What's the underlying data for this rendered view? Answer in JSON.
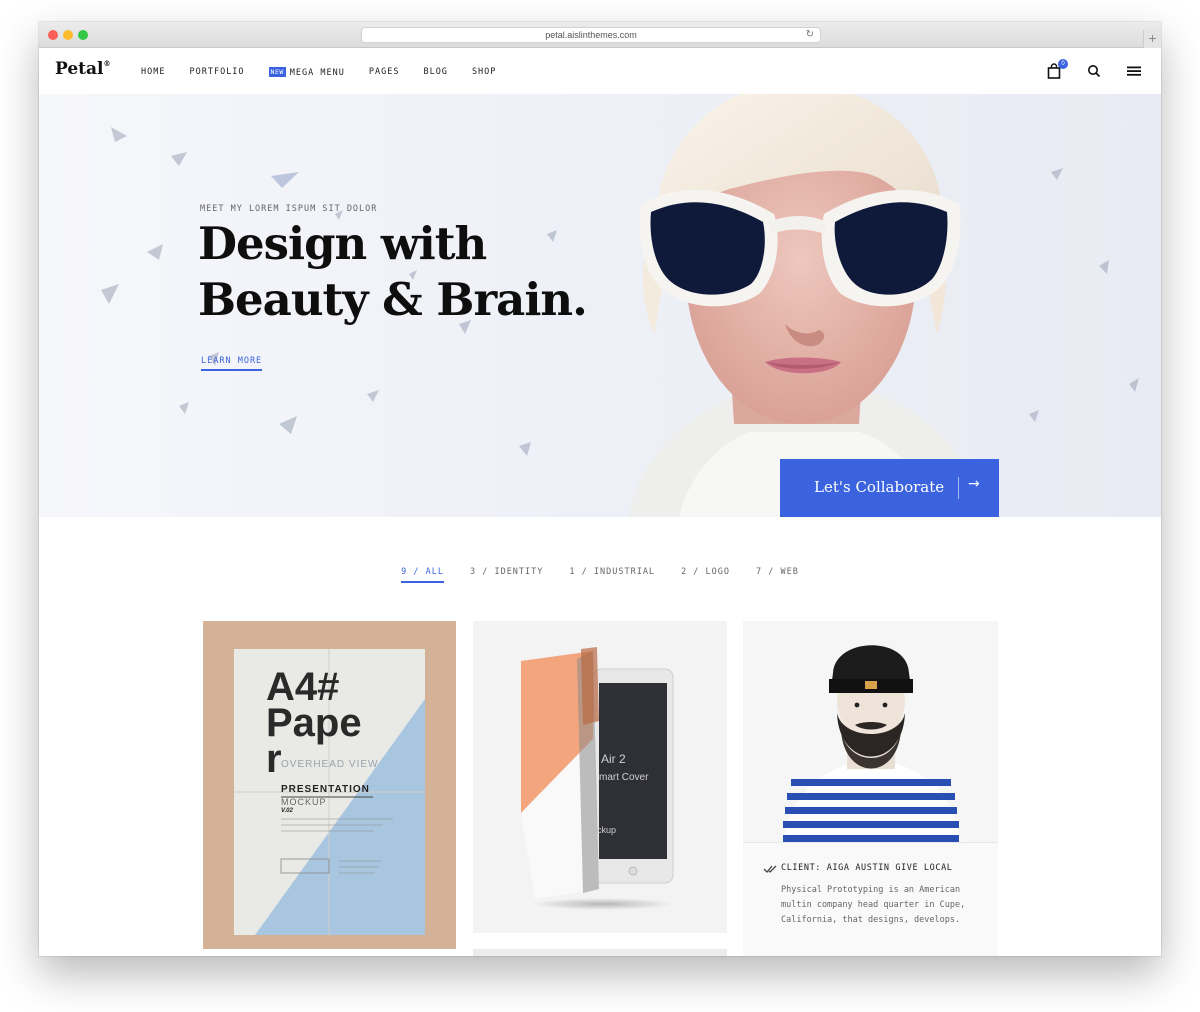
{
  "browser": {
    "url": "petal.aislinthemes.com"
  },
  "nav": {
    "logo": "Petal",
    "logo_mark": "®",
    "links": [
      "HOME",
      "PORTFOLIO",
      "MEGA MENU",
      "PAGES",
      "BLOG",
      "SHOP"
    ],
    "new_badge": "NEW",
    "cart_count": "0",
    "icons": [
      "bag-icon",
      "search-icon",
      "hamburger-icon"
    ]
  },
  "hero": {
    "eyebrow": "MEET MY LOREM ISPUM SIT DOLOR",
    "title_line1": "Design with",
    "title_line2": "Beauty & Brain.",
    "learn_more": "LEARN MORE",
    "cta": "Let's Collaborate",
    "cta_icon": "arrow-right-icon"
  },
  "filters": [
    {
      "label": "9 / ALL",
      "active": true
    },
    {
      "label": "3 / IDENTITY",
      "active": false
    },
    {
      "label": "1 / INDUSTRIAL",
      "active": false
    },
    {
      "label": "2 / LOGO",
      "active": false
    },
    {
      "label": "7 / WEB",
      "active": false
    }
  ],
  "cards": {
    "paper": {
      "line1": "A4#",
      "line2": "Pape",
      "line3": "r",
      "overhead": "OVERHEAD VIEW",
      "presentation": "PRESENTATION",
      "mockup": "MOCKUP",
      "version": "V.02"
    },
    "tablet": {
      "line1": "Air 2",
      "line2": "mart Cover",
      "line3": "ckup"
    },
    "client": {
      "client": "CLIENT: AIGA AUSTIN GIVE LOCAL",
      "description": "Physical Prototyping is an American multin company head quarter in Cupe, California, that designs, develops."
    }
  },
  "colors": {
    "accent": "#3b63e0",
    "text": "#0e0e0e"
  }
}
